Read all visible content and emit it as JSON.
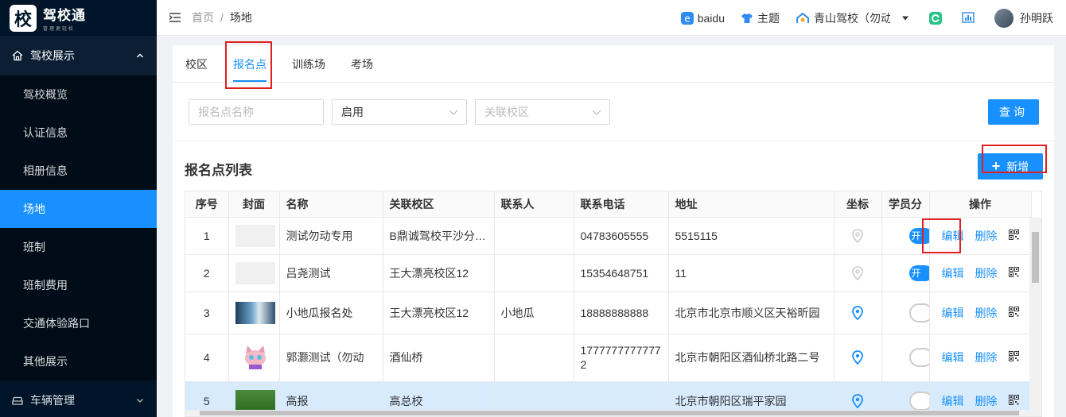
{
  "app": {
    "logo_char": "校",
    "logo_title": "驾校通",
    "logo_sub": "管理更轻松"
  },
  "sidebar": {
    "group_label": "驾校展示",
    "items": [
      {
        "label": "驾校概览",
        "active": false
      },
      {
        "label": "认证信息",
        "active": false
      },
      {
        "label": "相册信息",
        "active": false
      },
      {
        "label": "场地",
        "active": true
      },
      {
        "label": "班制",
        "active": false
      },
      {
        "label": "班制费用",
        "active": false
      },
      {
        "label": "交通体验路口",
        "active": false
      },
      {
        "label": "其他展示",
        "active": false
      }
    ],
    "bottom_group_label": "车辆管理"
  },
  "header": {
    "breadcrumb_home": "首页",
    "breadcrumb_sep": "/",
    "breadcrumb_current": "场地",
    "baidu": "baidu",
    "theme": "主题",
    "school": "青山驾校（勿动）",
    "user": "孙明跃"
  },
  "tabs": [
    {
      "label": "校区",
      "active": false
    },
    {
      "label": "报名点",
      "active": true
    },
    {
      "label": "训练场",
      "active": false
    },
    {
      "label": "考场",
      "active": false
    }
  ],
  "filters": {
    "name_placeholder": "报名点名称",
    "status_value": "启用",
    "campus_placeholder": "关联校区",
    "query_button": "查询"
  },
  "list": {
    "title": "报名点列表",
    "add_button": "新增"
  },
  "table": {
    "columns": [
      "序号",
      "封面",
      "名称",
      "关联校区",
      "联系人",
      "联系电话",
      "地址",
      "坐标",
      "学员分",
      "操作"
    ],
    "rows": [
      {
        "no": "1",
        "cover": "placeholder",
        "name": "测试勿动专用",
        "campus": "B鼎诚驾校平沙分校区",
        "contact": "",
        "phone": "04783605555",
        "address": "5515115",
        "coord_set": false,
        "switch_on": true,
        "switch_text": "开"
      },
      {
        "no": "2",
        "cover": "placeholder",
        "name": "吕尧测试",
        "campus": "王大漂亮校区12",
        "contact": "",
        "phone": "15354648751",
        "address": "11",
        "coord_set": false,
        "switch_on": true,
        "switch_text": "开"
      },
      {
        "no": "3",
        "cover": "photo",
        "name": "小地瓜报名处",
        "campus": "王大漂亮校区12",
        "contact": "小地瓜",
        "phone": "18888888888",
        "address": "北京市北京市顺义区天裕昕园",
        "coord_set": true,
        "switch_on": false,
        "switch_text": ""
      },
      {
        "no": "4",
        "cover": "cat",
        "name": "郭灏测试（勿动",
        "campus": "酒仙桥",
        "contact": "",
        "phone": "17777777777772",
        "address": "北京市朝阳区酒仙桥北路二号",
        "coord_set": true,
        "switch_on": false,
        "switch_text": ""
      },
      {
        "no": "5",
        "cover": "grass",
        "name": "高报",
        "campus": "高总校",
        "contact": "",
        "phone": "",
        "address": "北京市朝阳区瑞平家园",
        "coord_set": true,
        "switch_on": false,
        "switch_text": ""
      }
    ],
    "edit_label": "编辑",
    "delete_label": "删除"
  },
  "colors": {
    "primary": "#1890ff",
    "sidebar_bg": "#001529",
    "highlight_box": "#e02020"
  }
}
